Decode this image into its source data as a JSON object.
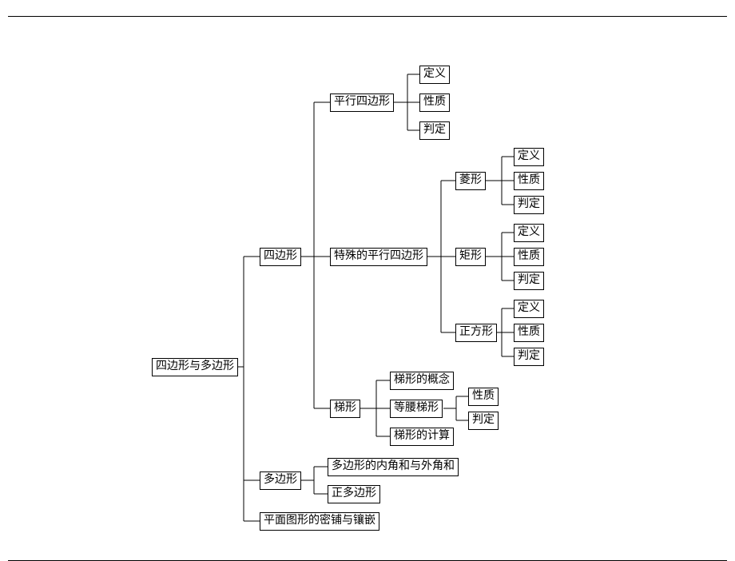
{
  "chart_data": {
    "type": "tree",
    "root": {
      "label": "四边形与多边形",
      "children": [
        {
          "label": "四边形",
          "children": [
            {
              "label": "平行四边形",
              "children": [
                {
                  "label": "定义"
                },
                {
                  "label": "性质"
                },
                {
                  "label": "判定"
                }
              ]
            },
            {
              "label": "特殊的平行四边形",
              "children": [
                {
                  "label": "菱形",
                  "children": [
                    {
                      "label": "定义"
                    },
                    {
                      "label": "性质"
                    },
                    {
                      "label": "判定"
                    }
                  ]
                },
                {
                  "label": "矩形",
                  "children": [
                    {
                      "label": "定义"
                    },
                    {
                      "label": "性质"
                    },
                    {
                      "label": "判定"
                    }
                  ]
                },
                {
                  "label": "正方形",
                  "children": [
                    {
                      "label": "定义"
                    },
                    {
                      "label": "性质"
                    },
                    {
                      "label": "判定"
                    }
                  ]
                }
              ]
            },
            {
              "label": "梯形",
              "children": [
                {
                  "label": "梯形的概念"
                },
                {
                  "label": "等腰梯形",
                  "children": [
                    {
                      "label": "性质"
                    },
                    {
                      "label": "判定"
                    }
                  ]
                },
                {
                  "label": "梯形的计算"
                }
              ]
            }
          ]
        },
        {
          "label": "多边形",
          "children": [
            {
              "label": "多边形的内角和与外角和"
            },
            {
              "label": "正多边形"
            }
          ]
        },
        {
          "label": "平面图形的密铺与镶嵌"
        }
      ]
    }
  },
  "nodes": {
    "root": "四边形与多边形",
    "quadrilateral": "四边形",
    "parallelogram": "平行四边形",
    "def1": "定义",
    "prop1": "性质",
    "judge1": "判定",
    "special_parallelogram": "特殊的平行四边形",
    "rhombus": "菱形",
    "def2": "定义",
    "prop2": "性质",
    "judge2": "判定",
    "rectangle": "矩形",
    "def3": "定义",
    "prop3": "性质",
    "judge3": "判定",
    "square": "正方形",
    "def4": "定义",
    "prop4": "性质",
    "judge4": "判定",
    "trapezoid": "梯形",
    "trap_concept": "梯形的概念",
    "iso_trap": "等腰梯形",
    "prop5": "性质",
    "judge5": "判定",
    "trap_calc": "梯形的计算",
    "polygon": "多边形",
    "poly_angles": "多边形的内角和与外角和",
    "regular_poly": "正多边形",
    "tessellation": "平面图形的密铺与镶嵌"
  }
}
